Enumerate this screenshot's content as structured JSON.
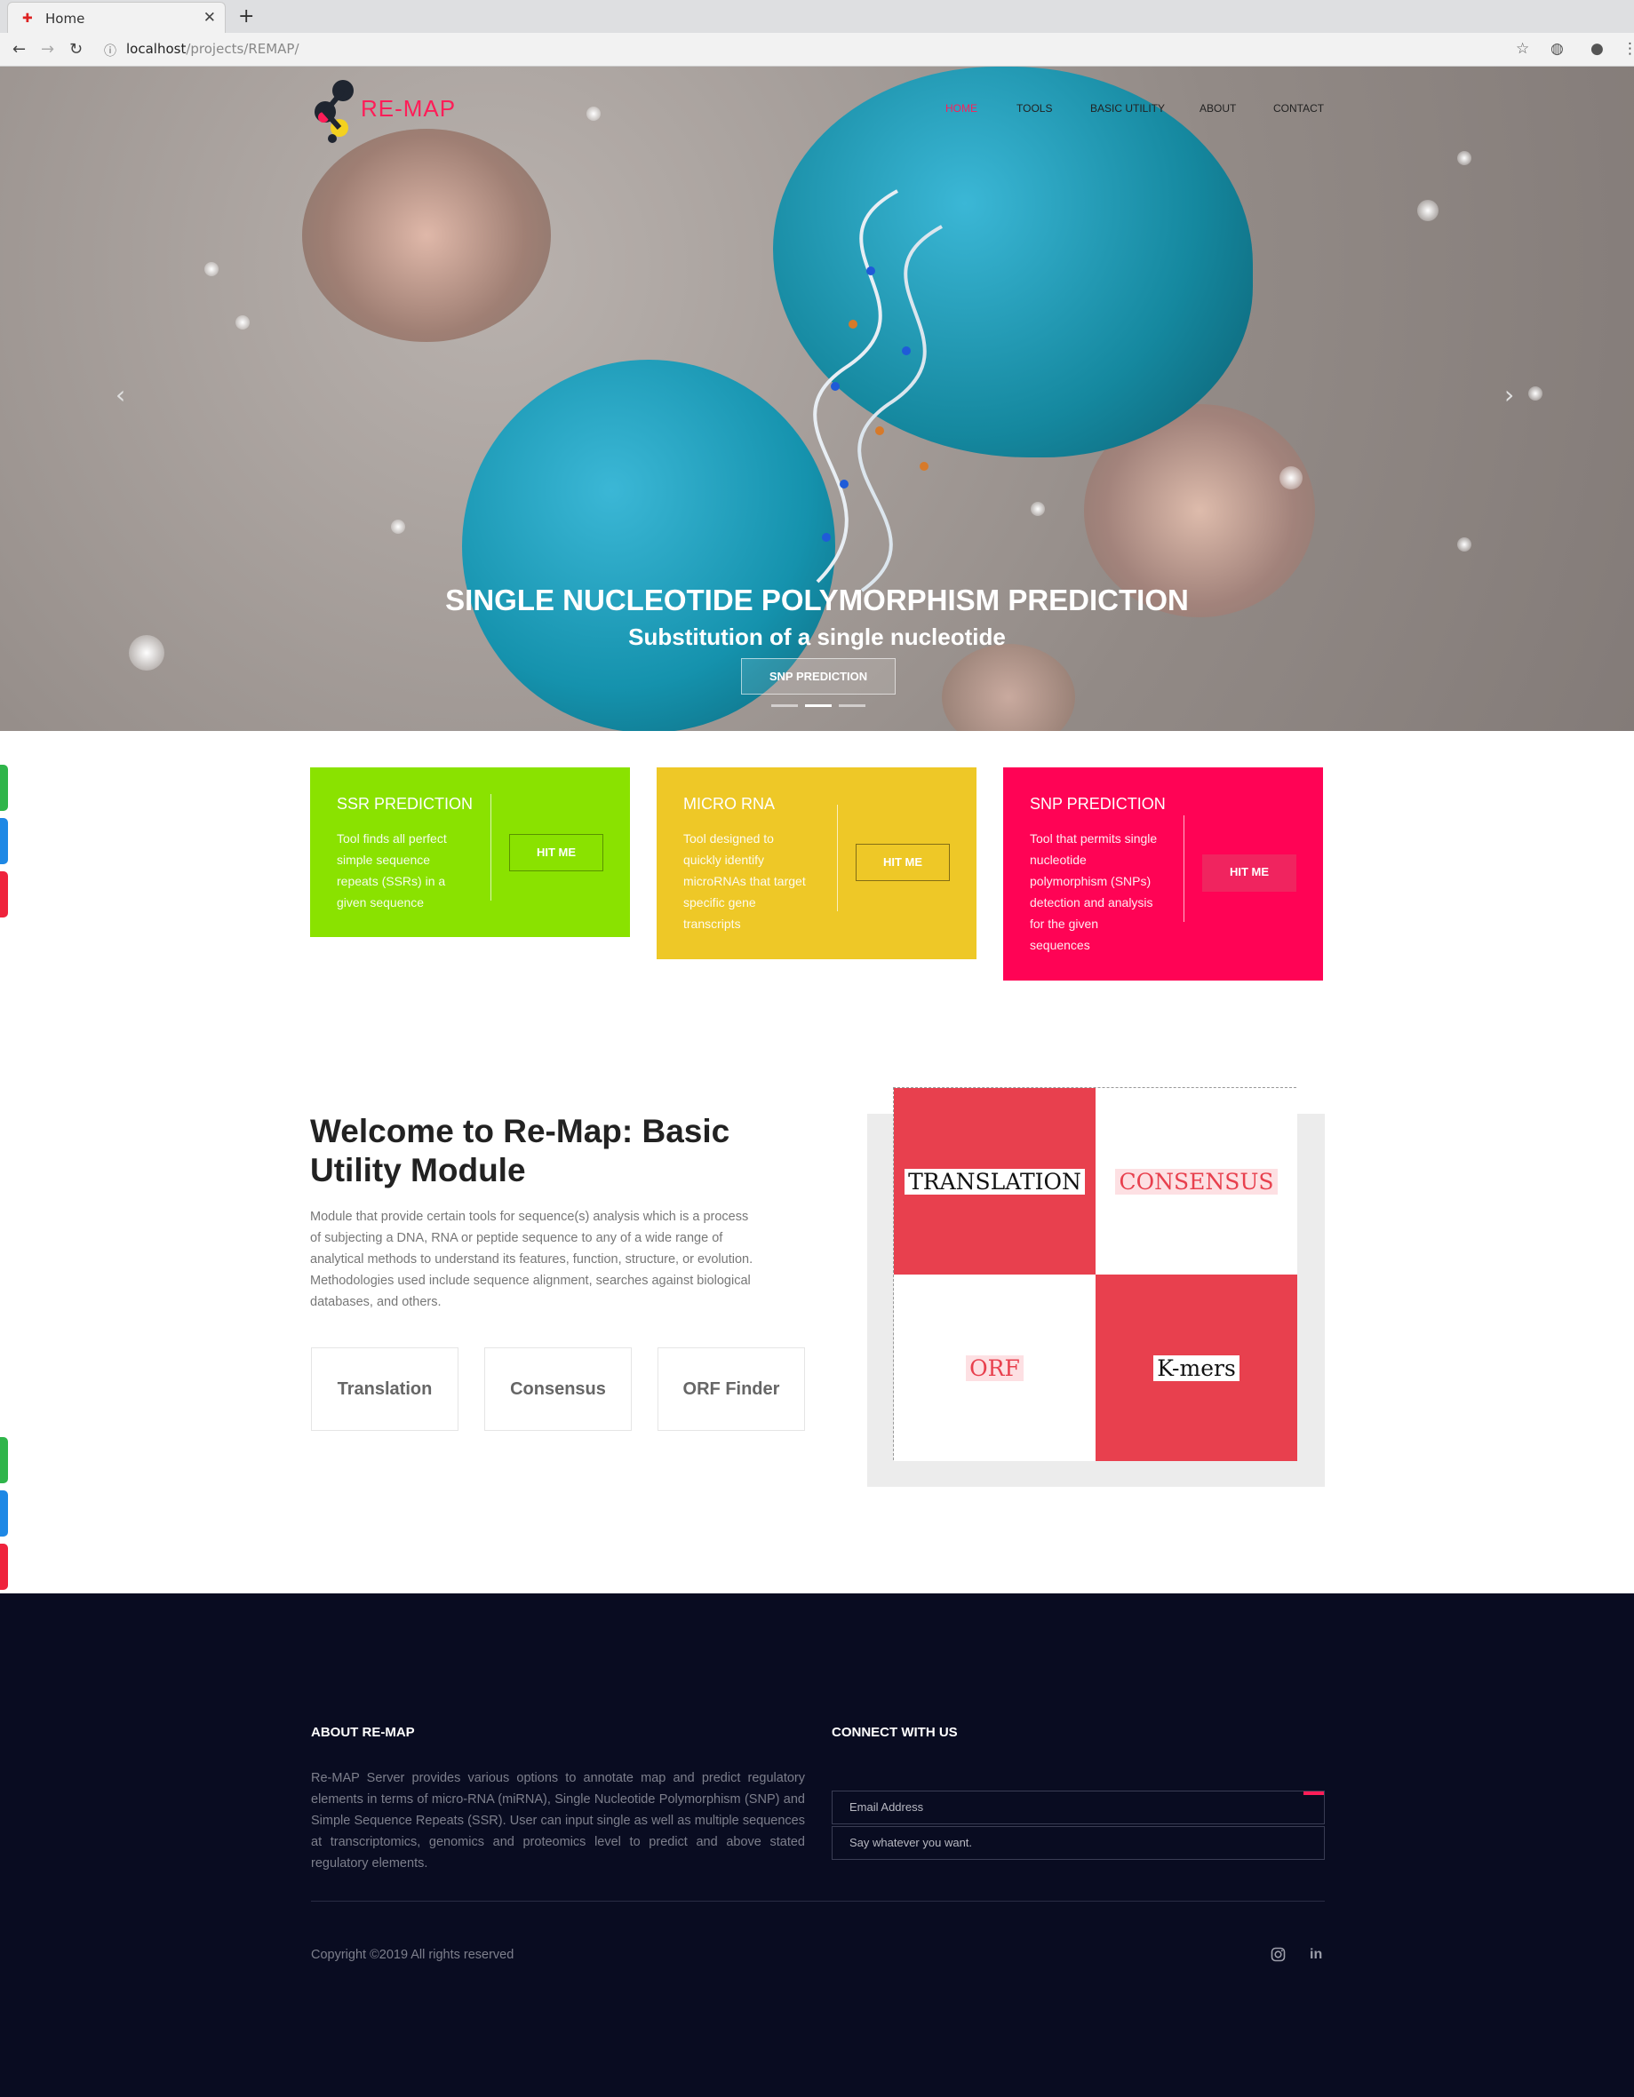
{
  "browser": {
    "tab_title": "Home",
    "url_host": "localhost",
    "url_path": "/projects/REMAP/"
  },
  "site": {
    "logo_text": "RE-MAP",
    "nav": [
      "HOME",
      "TOOLS",
      "BASIC UTILITY",
      "ABOUT",
      "CONTACT"
    ],
    "nav_active": "HOME",
    "accent_color": "#ff1d58"
  },
  "hero": {
    "title": "SINGLE NUCLEOTIDE POLYMORPHISM PREDICTION",
    "subtitle": "Substitution of a single nucleotide",
    "button": "SNP PREDICTION",
    "slide_count": 3,
    "active_slide": 2
  },
  "cards": [
    {
      "title": "SSR PREDICTION",
      "text": "Tool finds all perfect simple sequence repeats (SSRs) in a given sequence",
      "button": "HIT ME",
      "color": "#8ae200"
    },
    {
      "title": "MICRO RNA",
      "text": "Tool designed to quickly identify microRNAs that target specific gene transcripts",
      "button": "HIT ME",
      "color": "#eec827"
    },
    {
      "title": "SNP PREDICTION",
      "text": "Tool that permits single nucleotide polymorphism (SNPs) detection and analysis for the given sequences",
      "button": "HIT ME",
      "color": "#ff0355"
    }
  ],
  "welcome": {
    "heading": "Welcome to Re-Map: Basic Utility Module",
    "description": "Module that provide certain tools for sequence(s) analysis which is a process of subjecting a DNA, RNA or peptide sequence to any of a wide range of analytical methods to understand its features, function, structure, or evolution. Methodologies used include sequence alignment, searches against biological databases, and others.",
    "utilities": [
      "Translation",
      "Consensus",
      "ORF Finder"
    ]
  },
  "tool_grid": [
    "TRANSLATION",
    "CONSENSUS",
    "ORF",
    "K-mers"
  ],
  "footer": {
    "about_heading": "ABOUT RE-MAP",
    "about_text": "Re-MAP Server provides various options to annotate map and predict regulatory elements in terms of micro-RNA (miRNA), Single Nucleotide Polymorphism (SNP) and Simple Sequence Repeats (SSR). User can input single as well as multiple sequences at transcriptomics, genomics and proteomics level to predict and above stated regulatory elements.",
    "connect_heading": "CONNECT WITH US",
    "email_placeholder": "Email Address",
    "message_placeholder": "Say whatever you want.",
    "copyright": "Copyright ©2019 All rights reserved",
    "social": [
      "instagram-icon",
      "linkedin-icon"
    ]
  }
}
